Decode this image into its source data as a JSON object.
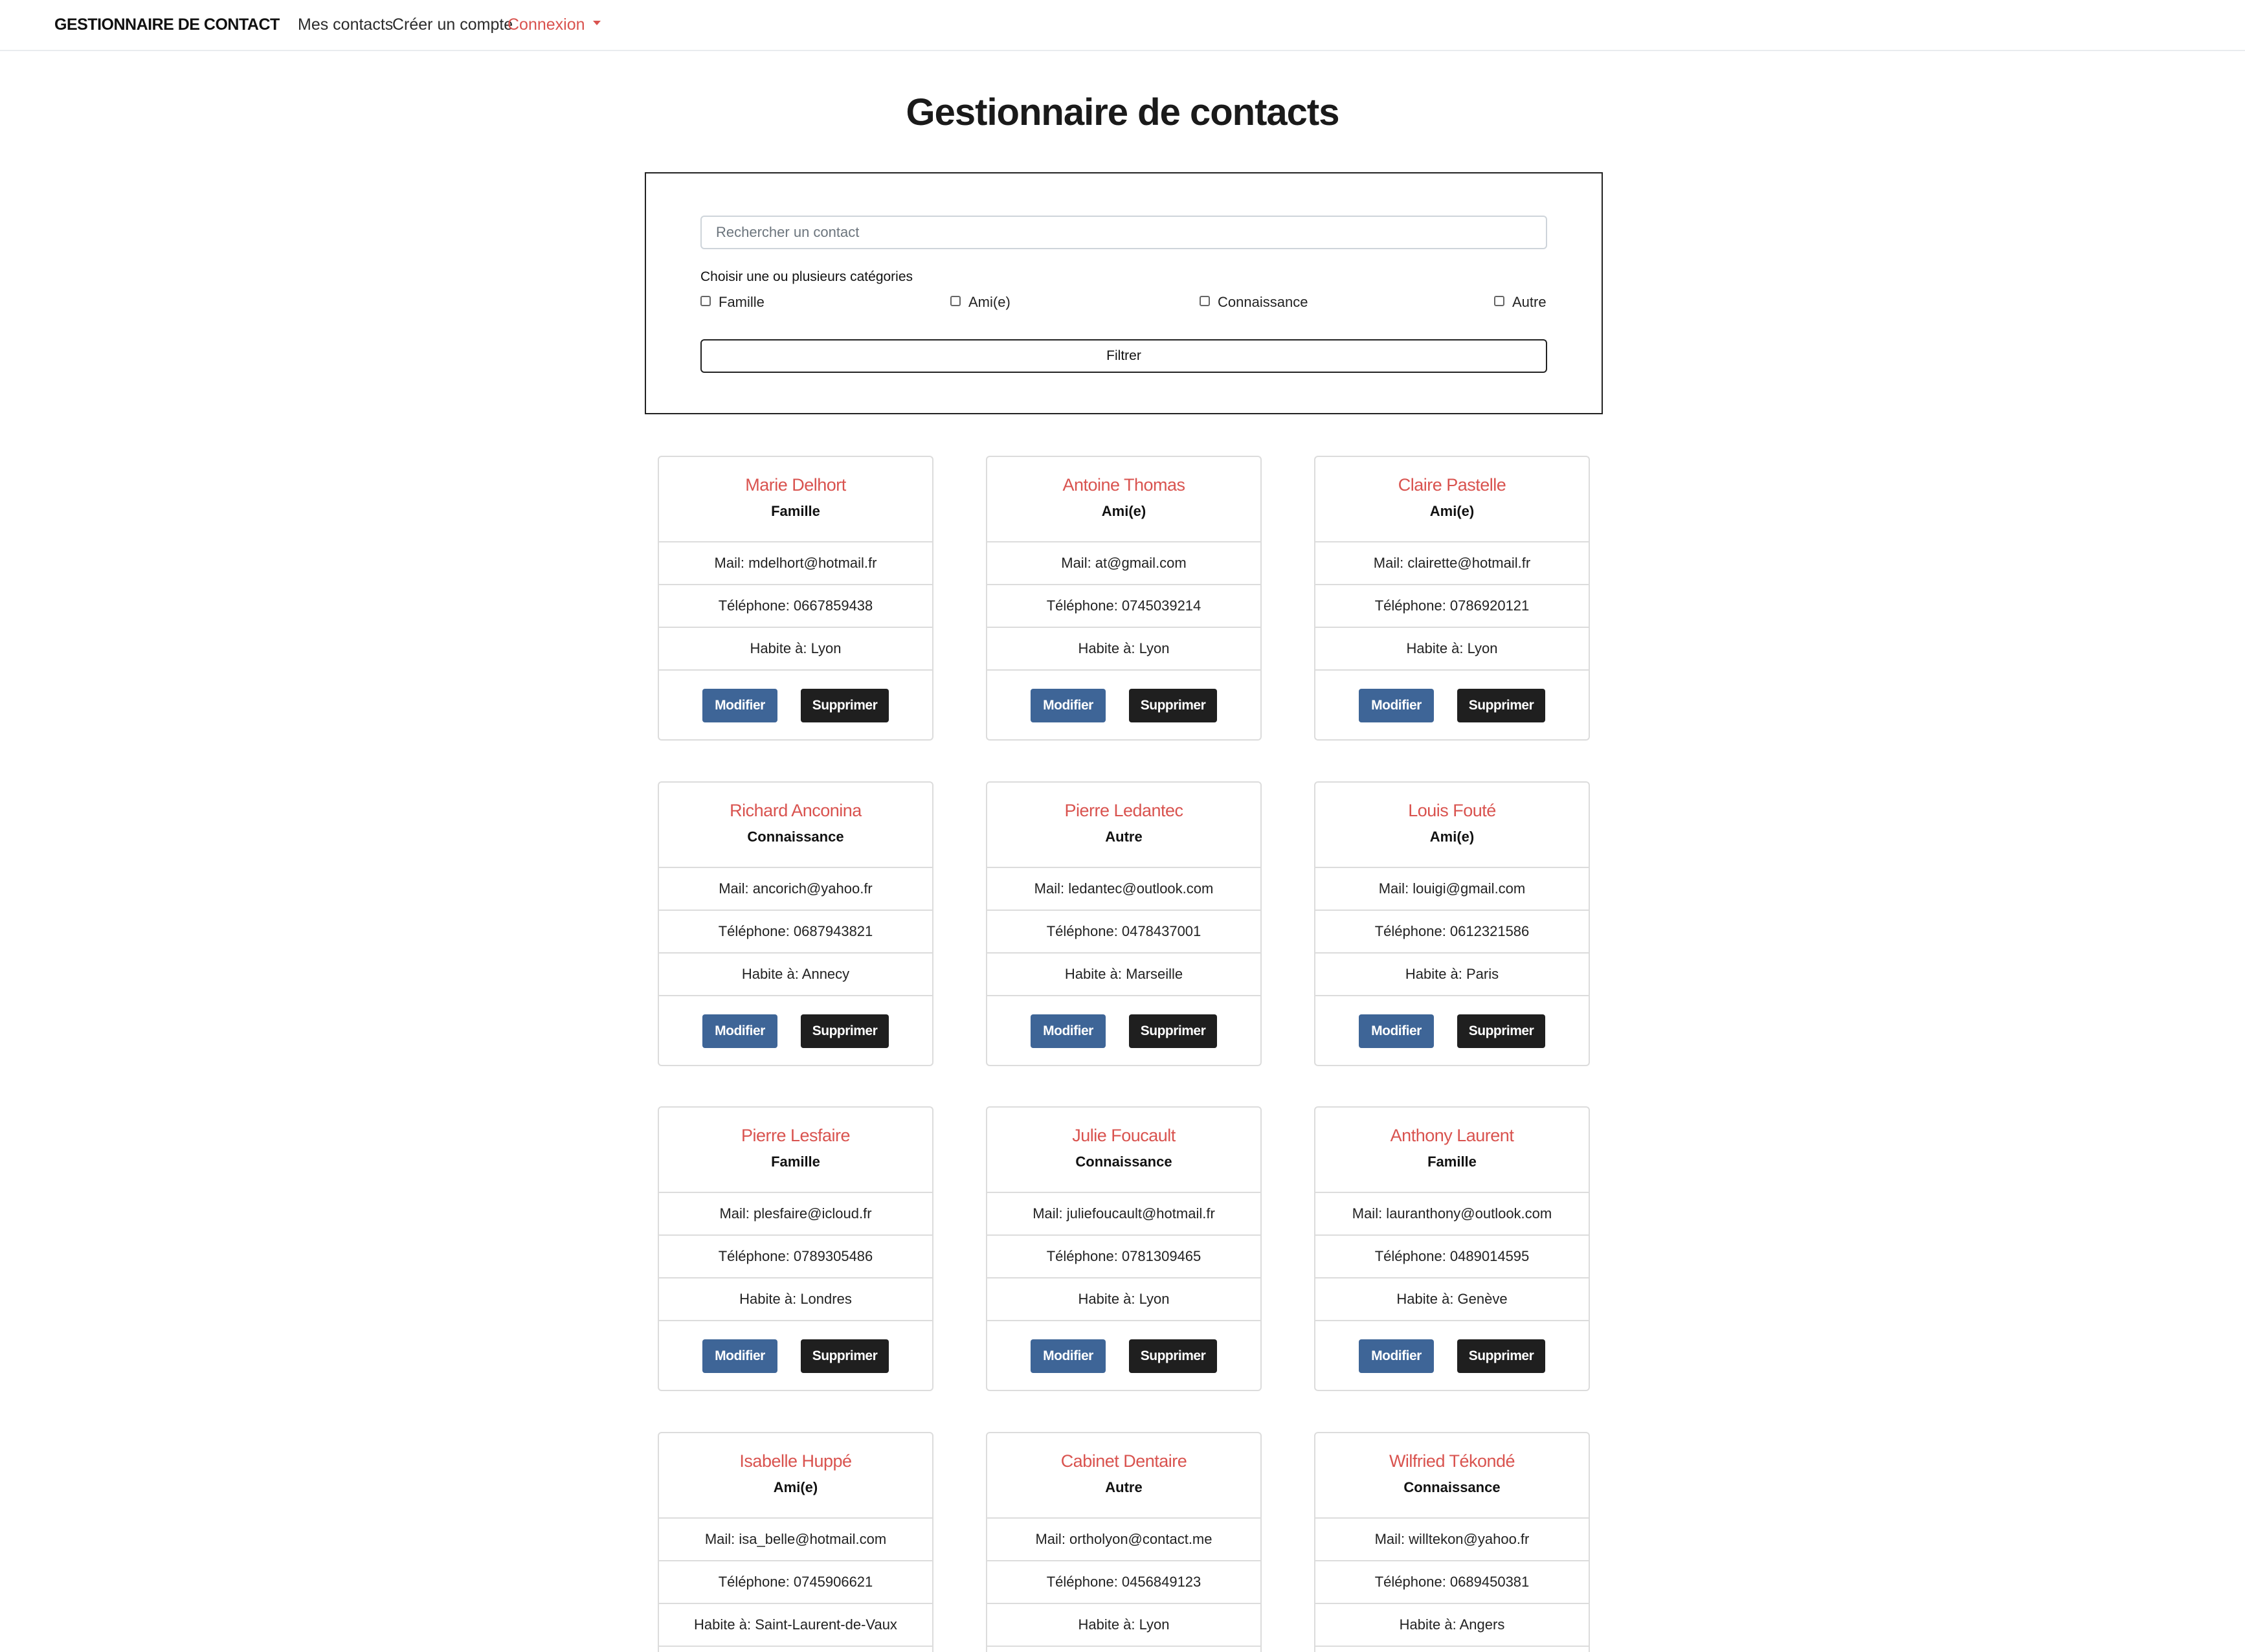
{
  "navbar": {
    "brand": "GESTIONNAIRE DE CONTACT",
    "links": [
      "Mes contacts",
      "Créer un compte",
      "Connexion"
    ]
  },
  "page_title": "Gestionnaire de contacts",
  "filter": {
    "search_placeholder": "Rechercher un contact",
    "categories_label": "Choisir une ou plusieurs catégories",
    "categories": [
      "Famille",
      "Ami(e)",
      "Connaissance",
      "Autre"
    ],
    "filter_button": "Filtrer"
  },
  "buttons": {
    "edit": "Modifier",
    "delete": "Supprimer"
  },
  "contacts": [
    {
      "name": "Marie Delhort",
      "category": "Famille",
      "mail": "Mail: mdelhort@hotmail.fr",
      "phone": "Téléphone: 0667859438",
      "city": "Habite à: Lyon"
    },
    {
      "name": "Antoine Thomas",
      "category": "Ami(e)",
      "mail": "Mail: at@gmail.com",
      "phone": "Téléphone: 0745039214",
      "city": "Habite à: Lyon"
    },
    {
      "name": "Claire Pastelle",
      "category": "Ami(e)",
      "mail": "Mail: clairette@hotmail.fr",
      "phone": "Téléphone: 0786920121",
      "city": "Habite à: Lyon"
    },
    {
      "name": "Richard Anconina",
      "category": "Connaissance",
      "mail": "Mail: ancorich@yahoo.fr",
      "phone": "Téléphone: 0687943821",
      "city": "Habite à: Annecy"
    },
    {
      "name": "Pierre Ledantec",
      "category": "Autre",
      "mail": "Mail: ledantec@outlook.com",
      "phone": "Téléphone: 0478437001",
      "city": "Habite à: Marseille"
    },
    {
      "name": "Louis Fouté",
      "category": "Ami(e)",
      "mail": "Mail: louigi@gmail.com",
      "phone": "Téléphone: 0612321586",
      "city": "Habite à: Paris"
    },
    {
      "name": "Pierre Lesfaire",
      "category": "Famille",
      "mail": "Mail: plesfaire@icloud.fr",
      "phone": "Téléphone: 0789305486",
      "city": "Habite à: Londres"
    },
    {
      "name": "Julie Foucault",
      "category": "Connaissance",
      "mail": "Mail: juliefoucault@hotmail.fr",
      "phone": "Téléphone: 0781309465",
      "city": "Habite à: Lyon"
    },
    {
      "name": "Anthony Laurent",
      "category": "Famille",
      "mail": "Mail: lauranthony@outlook.com",
      "phone": "Téléphone: 0489014595",
      "city": "Habite à: Genève"
    },
    {
      "name": "Isabelle Huppé",
      "category": "Ami(e)",
      "mail": "Mail: isa_belle@hotmail.com",
      "phone": "Téléphone: 0745906621",
      "city": "Habite à: Saint-Laurent-de-Vaux"
    },
    {
      "name": "Cabinet Dentaire",
      "category": "Autre",
      "mail": "Mail: ortholyon@contact.me",
      "phone": "Téléphone: 0456849123",
      "city": "Habite à: Lyon"
    },
    {
      "name": "Wilfried Tékondé",
      "category": "Connaissance",
      "mail": "Mail: willtekon@yahoo.fr",
      "phone": "Téléphone: 0689450381",
      "city": "Habite à: Angers"
    }
  ]
}
